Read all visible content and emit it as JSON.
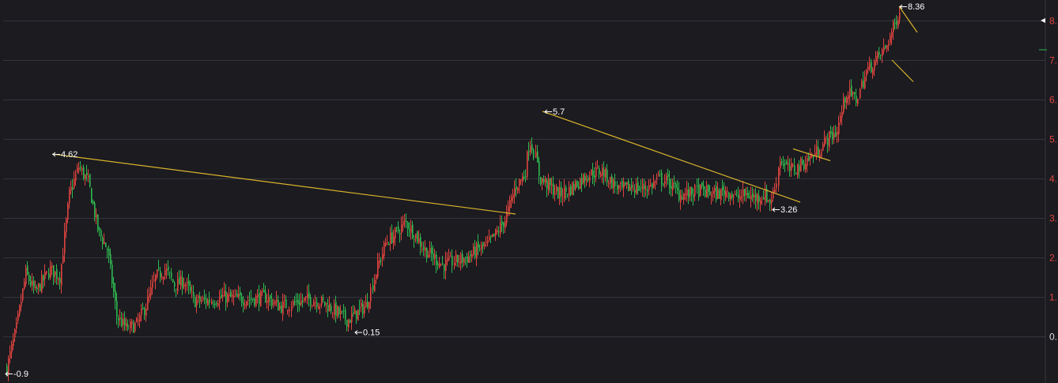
{
  "chart_data": {
    "type": "candlestick",
    "title": "",
    "xlabel": "",
    "ylabel": "",
    "grid": true,
    "ylim": [
      -0.5,
      8.5
    ],
    "colors": {
      "background": "#1b1b20",
      "grid": "#34343c",
      "up": "#e0443e",
      "down": "#2fb84f",
      "trendline": "#d9b22c",
      "axis_text": "#e0443e",
      "annotation": "#ffffff"
    },
    "y_ticks": [
      {
        "value": 8,
        "label": "8."
      },
      {
        "value": 7,
        "label": "7."
      },
      {
        "value": 6,
        "label": "6."
      },
      {
        "value": 5,
        "label": "5."
      },
      {
        "value": 4,
        "label": "4."
      },
      {
        "value": 3,
        "label": "3."
      },
      {
        "value": 2,
        "label": "2."
      },
      {
        "value": 1,
        "label": "1."
      },
      {
        "value": 0,
        "label": "0."
      }
    ],
    "price_path": [
      [
        0,
        -0.8
      ],
      [
        2,
        0.2
      ],
      [
        4,
        1.6
      ],
      [
        6,
        1.1
      ],
      [
        9,
        1.7
      ],
      [
        11,
        1.5
      ],
      [
        13,
        3.6
      ],
      [
        15,
        4.3
      ],
      [
        17,
        3.9
      ],
      [
        19,
        2.7
      ],
      [
        21,
        2.2
      ],
      [
        23,
        0.5
      ],
      [
        25,
        0.2
      ],
      [
        27,
        0.3
      ],
      [
        29,
        0.8
      ],
      [
        31,
        1.5
      ],
      [
        33,
        1.7
      ],
      [
        35,
        1.3
      ],
      [
        37,
        1.4
      ],
      [
        39,
        0.9
      ],
      [
        42,
        0.9
      ],
      [
        45,
        1.0
      ],
      [
        48,
        0.95
      ],
      [
        51,
        0.95
      ],
      [
        54,
        1.0
      ],
      [
        57,
        0.75
      ],
      [
        60,
        0.85
      ],
      [
        63,
        0.95
      ],
      [
        66,
        0.85
      ],
      [
        69,
        0.6
      ],
      [
        71,
        0.4
      ],
      [
        73,
        0.6
      ],
      [
        75,
        0.8
      ],
      [
        77,
        1.7
      ],
      [
        79,
        2.4
      ],
      [
        81,
        2.6
      ],
      [
        83,
        2.9
      ],
      [
        85,
        2.6
      ],
      [
        87,
        2.2
      ],
      [
        89,
        2.0
      ],
      [
        91,
        1.8
      ],
      [
        93,
        1.9
      ],
      [
        96,
        2.0
      ],
      [
        98,
        2.2
      ],
      [
        100,
        2.3
      ],
      [
        102,
        2.6
      ],
      [
        104,
        3.0
      ],
      [
        106,
        3.8
      ],
      [
        108,
        4.1
      ],
      [
        109,
        5.0
      ],
      [
        110,
        4.6
      ],
      [
        111,
        4.0
      ],
      [
        113,
        3.8
      ],
      [
        115,
        3.6
      ],
      [
        117,
        3.7
      ],
      [
        119,
        3.9
      ],
      [
        121,
        4.1
      ],
      [
        124,
        4.2
      ],
      [
        126,
        3.9
      ],
      [
        128,
        3.7
      ],
      [
        130,
        3.8
      ],
      [
        132,
        3.75
      ],
      [
        134,
        3.8
      ],
      [
        136,
        4.0
      ],
      [
        138,
        3.9
      ],
      [
        140,
        3.6
      ],
      [
        142,
        3.6
      ],
      [
        144,
        3.7
      ],
      [
        146,
        3.65
      ],
      [
        148,
        3.6
      ],
      [
        150,
        3.7
      ],
      [
        152,
        3.5
      ],
      [
        154,
        3.6
      ],
      [
        156,
        3.5
      ],
      [
        158,
        3.6
      ],
      [
        159,
        3.4
      ],
      [
        160,
        3.7
      ],
      [
        161,
        4.5
      ],
      [
        163,
        4.2
      ],
      [
        165,
        4.3
      ],
      [
        167,
        4.5
      ],
      [
        169,
        4.7
      ],
      [
        171,
        5.0
      ],
      [
        173,
        5.2
      ],
      [
        175,
        6.2
      ],
      [
        177,
        6.0
      ],
      [
        179,
        6.7
      ],
      [
        181,
        7.0
      ],
      [
        183,
        7.3
      ],
      [
        185,
        7.9
      ],
      [
        186,
        8.3
      ]
    ],
    "annotations": [
      {
        "label": "4.62",
        "value": 4.62,
        "kind": "high"
      },
      {
        "label": "0.15",
        "value": 0.15,
        "kind": "low"
      },
      {
        "label": "5.7",
        "value": 5.7,
        "kind": "high"
      },
      {
        "label": "3.26",
        "value": 3.26,
        "kind": "low"
      },
      {
        "label": "8.36",
        "value": 8.36,
        "kind": "high"
      },
      {
        "label": "-0.9",
        "value": -0.9,
        "kind": "low"
      }
    ],
    "trendlines": [
      {
        "from": 4.62,
        "to": 3.1
      },
      {
        "from": 5.7,
        "to": 3.4
      },
      {
        "from": 4.75,
        "to": 4.45
      },
      {
        "from": 8.36,
        "to": 7.7
      },
      {
        "from": 7.0,
        "to": 6.45
      }
    ]
  }
}
